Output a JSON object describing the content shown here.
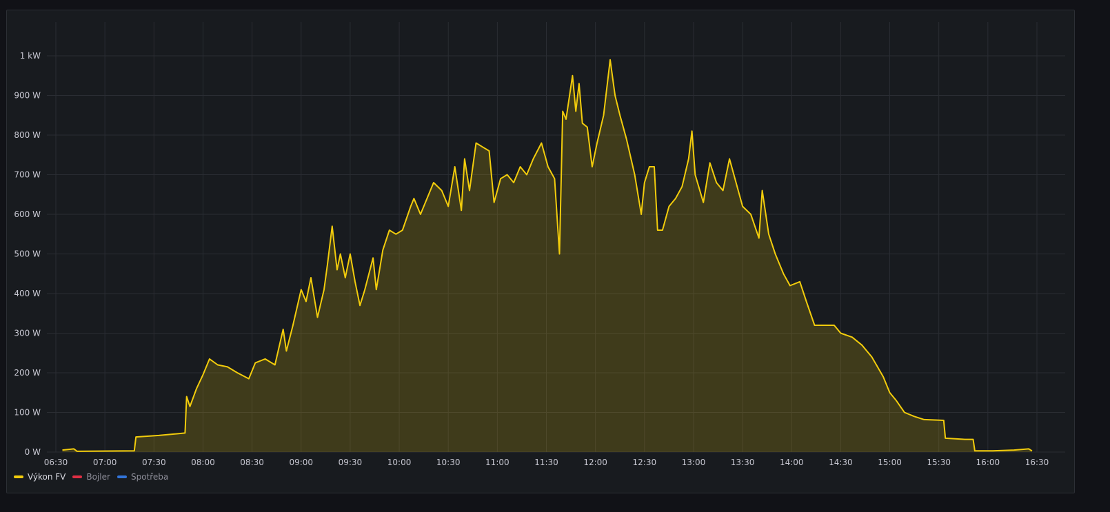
{
  "chart_data": {
    "type": "area",
    "title": "",
    "xlabel": "",
    "ylabel": "",
    "x_range": [
      "06:30",
      "16:30"
    ],
    "ylim": [
      0,
      1000
    ],
    "grid": true,
    "legend_placement": "bottom-left",
    "x_ticks": [
      "06:30",
      "07:00",
      "07:30",
      "08:00",
      "08:30",
      "09:00",
      "09:30",
      "10:00",
      "10:30",
      "11:00",
      "11:30",
      "12:00",
      "12:30",
      "13:00",
      "13:30",
      "14:00",
      "14:30",
      "15:00",
      "15:30",
      "16:00",
      "16:30"
    ],
    "y_ticks": [
      {
        "value": 0,
        "label": "0 W"
      },
      {
        "value": 100,
        "label": "100 W"
      },
      {
        "value": 200,
        "label": "200 W"
      },
      {
        "value": 300,
        "label": "300 W"
      },
      {
        "value": 400,
        "label": "400 W"
      },
      {
        "value": 500,
        "label": "500 W"
      },
      {
        "value": 600,
        "label": "600 W"
      },
      {
        "value": 700,
        "label": "700 W"
      },
      {
        "value": 800,
        "label": "800 W"
      },
      {
        "value": 900,
        "label": "900 W"
      },
      {
        "value": 1000,
        "label": "1 kW"
      }
    ],
    "series": [
      {
        "name": "Výkon FV",
        "color": "#f2cc0c",
        "fill": true,
        "x": [
          "06:34",
          "06:41",
          "06:43",
          "07:18",
          "07:19",
          "07:33",
          "07:49",
          "07:50",
          "07:52",
          "07:56",
          "08:00",
          "08:04",
          "08:09",
          "08:15",
          "08:21",
          "08:28",
          "08:32",
          "08:38",
          "08:44",
          "08:49",
          "08:51",
          "08:55",
          "09:00",
          "09:03",
          "09:06",
          "09:10",
          "09:14",
          "09:16",
          "09:19",
          "09:22",
          "09:24",
          "09:27",
          "09:30",
          "09:33",
          "09:36",
          "09:39",
          "09:44",
          "09:46",
          "09:50",
          "09:54",
          "09:58",
          "10:02",
          "10:07",
          "10:09",
          "10:13",
          "10:17",
          "10:21",
          "10:26",
          "10:30",
          "10:34",
          "10:38",
          "10:40",
          "10:43",
          "10:47",
          "10:51",
          "10:55",
          "10:58",
          "11:02",
          "11:06",
          "11:10",
          "11:14",
          "11:18",
          "11:22",
          "11:27",
          "11:31",
          "11:35",
          "11:38",
          "11:40",
          "11:42",
          "11:46",
          "11:48",
          "11:50",
          "11:52",
          "11:55",
          "11:58",
          "12:01",
          "12:05",
          "12:09",
          "12:12",
          "12:15",
          "12:19",
          "12:24",
          "12:28",
          "12:30",
          "12:33",
          "12:36",
          "12:38",
          "12:41",
          "12:45",
          "12:49",
          "12:53",
          "12:57",
          "12:59",
          "13:01",
          "13:06",
          "13:10",
          "13:14",
          "13:18",
          "13:22",
          "13:26",
          "13:30",
          "13:35",
          "13:40",
          "13:42",
          "13:46",
          "13:50",
          "13:55",
          "13:59",
          "14:05",
          "14:09",
          "14:14",
          "14:20",
          "14:26",
          "14:30",
          "14:37",
          "14:43",
          "14:49",
          "14:56",
          "15:00",
          "15:04",
          "15:09",
          "15:15",
          "15:21",
          "15:33",
          "15:34",
          "15:46",
          "15:51",
          "15:52",
          "16:03",
          "16:16",
          "16:25",
          "16:27"
        ],
        "values": [
          5,
          8,
          2,
          3,
          38,
          42,
          48,
          140,
          115,
          160,
          195,
          235,
          220,
          215,
          200,
          185,
          225,
          235,
          220,
          310,
          255,
          320,
          410,
          380,
          440,
          340,
          410,
          470,
          570,
          460,
          500,
          440,
          500,
          430,
          370,
          410,
          490,
          410,
          510,
          560,
          550,
          560,
          620,
          640,
          600,
          640,
          680,
          660,
          620,
          720,
          610,
          740,
          660,
          780,
          770,
          760,
          630,
          690,
          700,
          680,
          720,
          700,
          740,
          780,
          720,
          690,
          500,
          860,
          840,
          950,
          860,
          930,
          830,
          820,
          720,
          780,
          850,
          990,
          900,
          850,
          790,
          700,
          600,
          680,
          720,
          720,
          560,
          560,
          620,
          640,
          670,
          740,
          810,
          700,
          630,
          730,
          680,
          660,
          740,
          680,
          620,
          600,
          540,
          660,
          550,
          500,
          450,
          420,
          430,
          380,
          320,
          320,
          320,
          300,
          290,
          270,
          240,
          190,
          150,
          130,
          100,
          90,
          82,
          80,
          35,
          32,
          32,
          3,
          3,
          5,
          8,
          3
        ]
      },
      {
        "name": "Bojler",
        "color": "#e02f44",
        "fill": false,
        "x": [],
        "values": []
      },
      {
        "name": "Spotřeba",
        "color": "#3274d9",
        "fill": false,
        "x": [],
        "values": []
      }
    ]
  }
}
